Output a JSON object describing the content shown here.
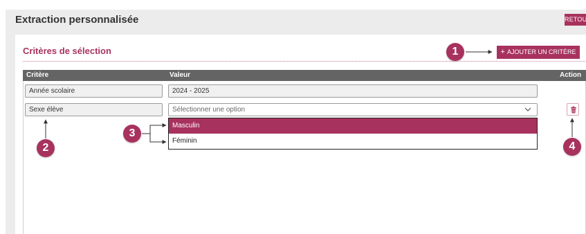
{
  "page": {
    "title": "Extraction personnalisée",
    "back_label": "RETOUR"
  },
  "section": {
    "title": "Critères de sélection",
    "add_button_label": "AJOUTER UN CRITÈRE",
    "add_icon": "+"
  },
  "table": {
    "headers": {
      "criterion": "Critère",
      "value": "Valeur",
      "action": "Action"
    },
    "rows": [
      {
        "criterion": "Année scolaire",
        "value": "2024 - 2025"
      },
      {
        "criterion": "Sexe élève",
        "value_placeholder": "Sélectionner une option"
      }
    ]
  },
  "dropdown": {
    "options": [
      "Masculin",
      "Féminin"
    ],
    "highlighted": "Masculin"
  },
  "annotations": {
    "badges": [
      "1",
      "2",
      "3",
      "4"
    ]
  },
  "icons": {
    "chevron": "chevron-down-icon",
    "delete": "trash-icon"
  },
  "colors": {
    "accent": "#a8325e",
    "header_bg": "#646464",
    "frame_bg": "#ececec"
  }
}
